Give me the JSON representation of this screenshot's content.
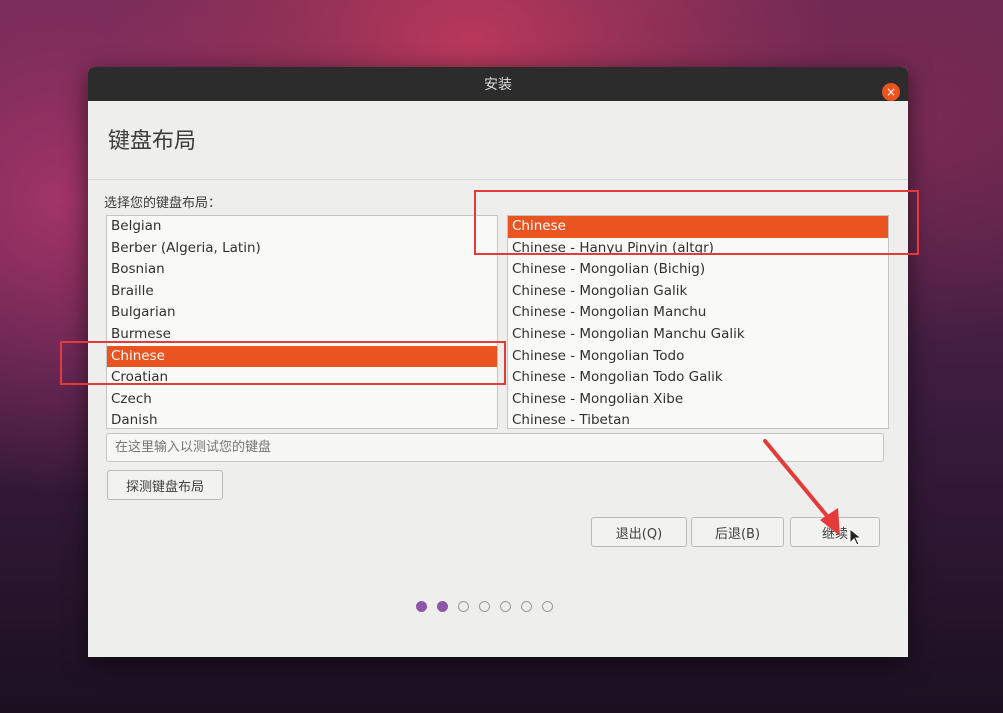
{
  "window": {
    "title": "安装",
    "close_glyph": "×"
  },
  "page": {
    "title": "键盘布局",
    "prompt": "选择您的键盘布局："
  },
  "layouts": [
    {
      "label": "Belgian"
    },
    {
      "label": "Berber (Algeria, Latin)"
    },
    {
      "label": "Bosnian"
    },
    {
      "label": "Braille"
    },
    {
      "label": "Bulgarian"
    },
    {
      "label": "Burmese"
    },
    {
      "label": "Chinese",
      "selected": true
    },
    {
      "label": "Croatian"
    },
    {
      "label": "Czech"
    },
    {
      "label": "Danish"
    }
  ],
  "variants": [
    {
      "label": "Chinese",
      "selected": true
    },
    {
      "label": "Chinese - Hanyu Pinyin (altgr)"
    },
    {
      "label": "Chinese - Mongolian (Bichig)"
    },
    {
      "label": "Chinese - Mongolian Galik"
    },
    {
      "label": "Chinese - Mongolian Manchu"
    },
    {
      "label": "Chinese - Mongolian Manchu Galik"
    },
    {
      "label": "Chinese - Mongolian Todo"
    },
    {
      "label": "Chinese - Mongolian Todo Galik"
    },
    {
      "label": "Chinese - Mongolian Xibe"
    },
    {
      "label": "Chinese - Tibetan"
    }
  ],
  "test_input": {
    "placeholder": "在这里输入以测试您的键盘",
    "value": ""
  },
  "buttons": {
    "detect": "探测键盘布局",
    "quit": "退出(Q)",
    "back": "后退(B)",
    "continue": "继续"
  },
  "progress": {
    "total_steps": 7,
    "completed_steps": 2
  },
  "colors": {
    "accent": "#e95420",
    "titlebar": "#2c2c2c",
    "dialog_bg": "#eeeeec",
    "progress_dot": "#8d56a7",
    "annotation": "#e43a3a"
  },
  "icons": {
    "close": "close-icon",
    "cursor": "mouse-cursor-icon"
  }
}
